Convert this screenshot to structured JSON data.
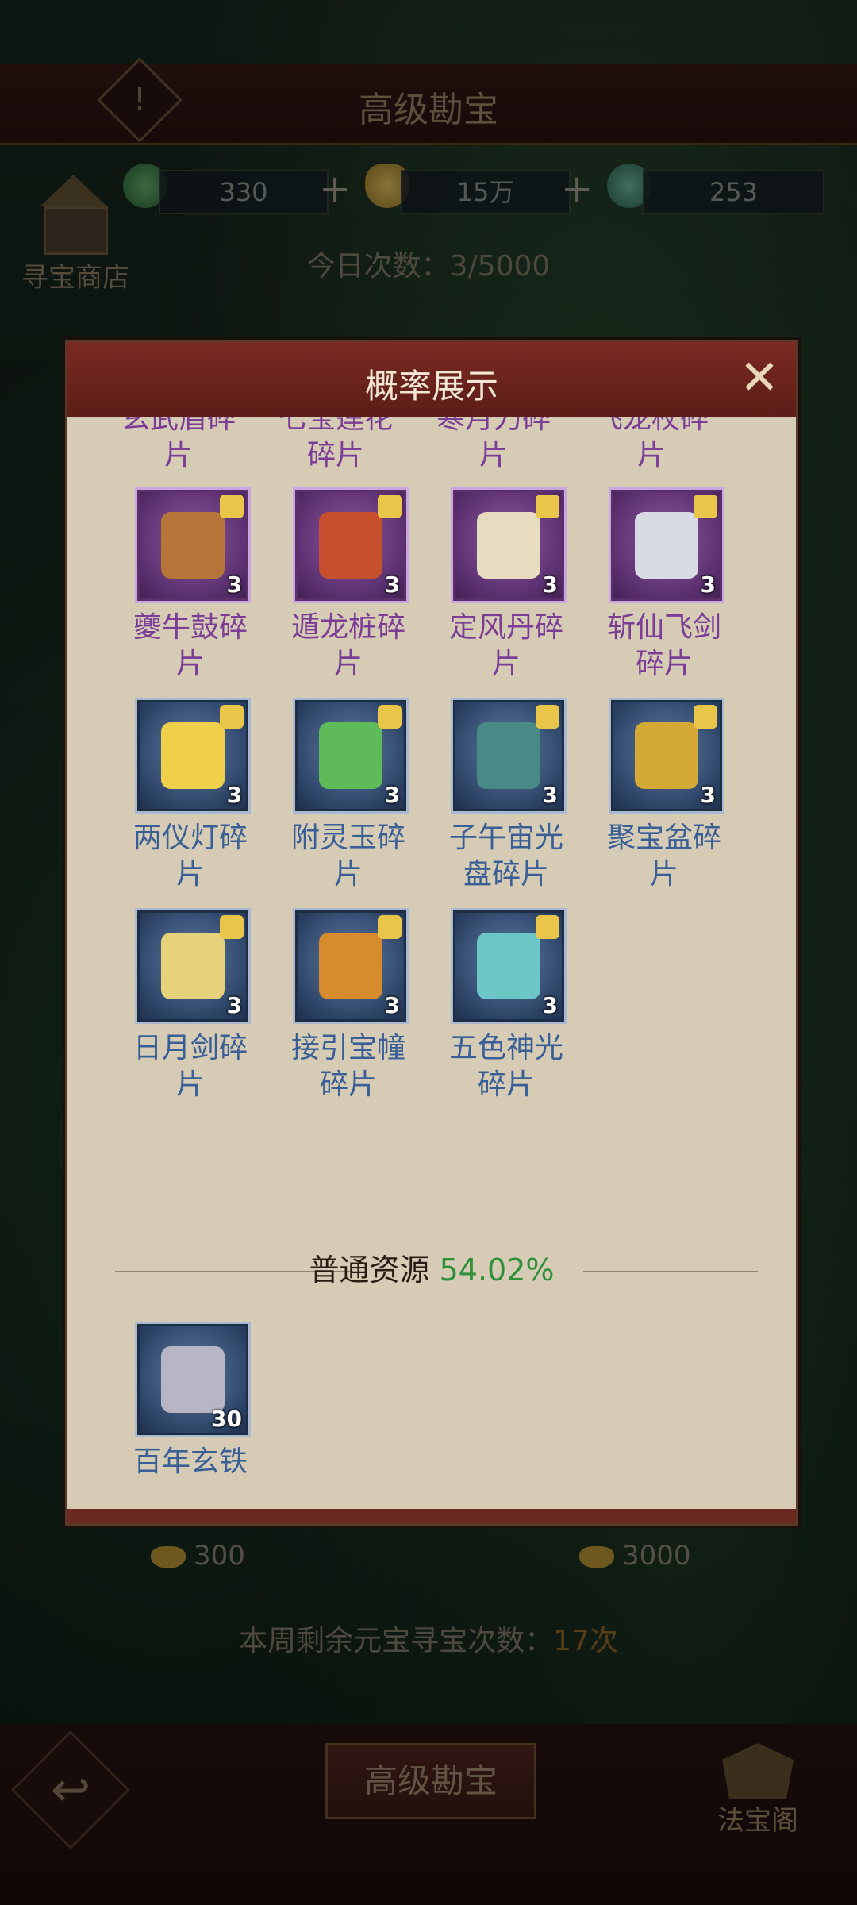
{
  "window": {
    "title": "高级勘宝"
  },
  "resources": [
    {
      "icon": "jade-coin-icon",
      "value": "330"
    },
    {
      "icon": "gold-ingot-icon",
      "value": "15万"
    },
    {
      "icon": "jade-ring-icon",
      "value": "253"
    }
  ],
  "shop_label": "寻宝商店",
  "daily_count": "今日次数：3/5000",
  "modal": {
    "title": "概率展示",
    "top_partial_row": [
      "玄武盾碎片",
      "七宝莲花碎片",
      "寒月刀碎片",
      "飞龙杖碎片"
    ],
    "items": [
      {
        "name": "夔牛鼓碎片",
        "count": "3",
        "rarity": "purple",
        "color": "#b6763a"
      },
      {
        "name": "遁龙桩碎片",
        "count": "3",
        "rarity": "purple",
        "color": "#c6502e"
      },
      {
        "name": "定风丹碎片",
        "count": "3",
        "rarity": "purple",
        "color": "#e8dcc0"
      },
      {
        "name": "斩仙飞剑碎片",
        "count": "3",
        "rarity": "purple",
        "color": "#d9dbe4"
      },
      {
        "name": "两仪灯碎片",
        "count": "3",
        "rarity": "blue",
        "color": "#f0d04a"
      },
      {
        "name": "附灵玉碎片",
        "count": "3",
        "rarity": "blue",
        "color": "#5fbb5a"
      },
      {
        "name": "子午宙光盘碎片",
        "count": "3",
        "rarity": "blue",
        "color": "#4a8a86"
      },
      {
        "name": "聚宝盆碎片",
        "count": "3",
        "rarity": "blue",
        "color": "#d4a935"
      },
      {
        "name": "日月剑碎片",
        "count": "3",
        "rarity": "blue",
        "color": "#e6d27a"
      },
      {
        "name": "接引宝幢碎片",
        "count": "3",
        "rarity": "blue",
        "color": "#d68b2c"
      },
      {
        "name": "五色神光碎片",
        "count": "3",
        "rarity": "blue",
        "color": "#6cc6c6"
      }
    ],
    "section": {
      "label": "普通资源",
      "percent": "54.02%"
    },
    "common_items": [
      {
        "name": "百年玄铁",
        "count": "30",
        "rarity": "blue",
        "color": "#b8b6c4"
      }
    ]
  },
  "prices": [
    {
      "icon": "gold-ingot-icon",
      "value": "300"
    },
    {
      "icon": "gold-ingot-icon",
      "value": "3000"
    }
  ],
  "weekly": {
    "label": "本周剩余元宝寻宝次数：",
    "count": "17次"
  },
  "bottom": {
    "main_button": "高级勘宝",
    "right_label": "法宝阁"
  }
}
